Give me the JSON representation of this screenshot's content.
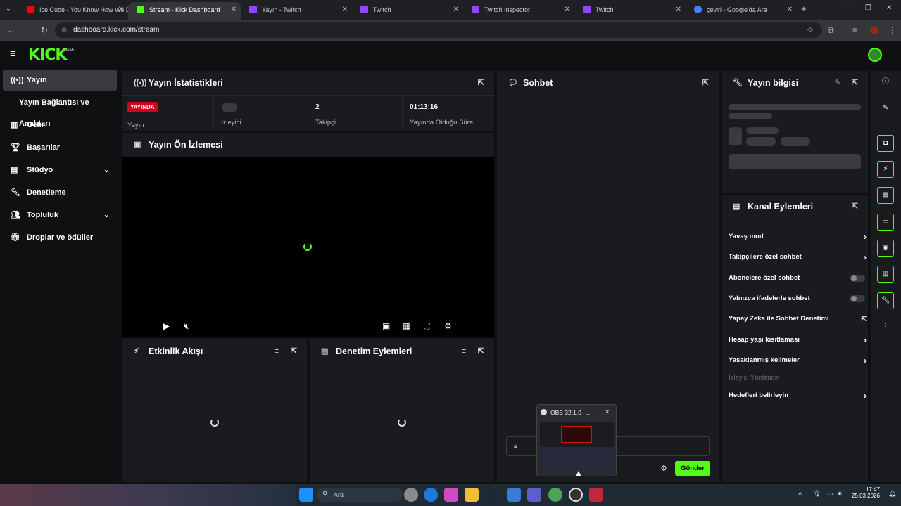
{
  "browser": {
    "tabs": [
      {
        "title": "Ice Cube - You Know How We D",
        "color": "#ff0000"
      },
      {
        "title": "Stream - Kick Dashboard",
        "color": "#53fc18"
      },
      {
        "title": "Yayın - Twitch",
        "color": "#9146ff"
      },
      {
        "title": "Twitch",
        "color": "#9146ff"
      },
      {
        "title": "Twitch Inspector",
        "color": "#9146ff"
      },
      {
        "title": "Twitch",
        "color": "#9146ff"
      },
      {
        "title": "çeviri - Google'da Ara",
        "color": "#4285f4"
      }
    ],
    "url": "dashboard.kick.com/stream"
  },
  "app": {
    "logo": "KICK",
    "beta": "BETA"
  },
  "sidebar": {
    "items": [
      {
        "label": "Yayın",
        "icon": "broadcast-icon"
      },
      {
        "label": "Yayın Bağlantısı ve Anahtarı",
        "icon": ""
      },
      {
        "label": "Gelir",
        "icon": "chart-icon"
      },
      {
        "label": "Başarılar",
        "icon": "trophy-icon"
      },
      {
        "label": "Stüdyo",
        "icon": "studio-icon"
      },
      {
        "label": "Denetleme",
        "icon": "wrench-icon"
      },
      {
        "label": "Topluluk",
        "icon": "people-icon"
      },
      {
        "label": "Droplar ve ödüller",
        "icon": "gift-icon"
      }
    ]
  },
  "stats": {
    "title": "Yayın İstatistikleri",
    "live_badge": "YAYINDA",
    "live_label": "Yayın",
    "viewers_label": "İzleyici",
    "followers_value": "2",
    "followers_label": "Takipçi",
    "uptime_value": "01:13:16",
    "uptime_label": "Yayında Olduğu Süre"
  },
  "preview": {
    "title": "Yayın Ön İzlemesi"
  },
  "activity": {
    "title": "Etkinlik Akışı"
  },
  "moderation": {
    "title": "Denetim Eylemleri"
  },
  "chat": {
    "title": "Sohbet",
    "send_label": "Gönder"
  },
  "info": {
    "title": "Yayın bilgisi"
  },
  "channel_actions": {
    "title": "Kanal Eylemleri",
    "items": [
      {
        "label": "Yavaş mod",
        "kind": "arrow"
      },
      {
        "label": "Takipçilere özel sohbet",
        "kind": "arrow"
      },
      {
        "label": "Abonelere özel sohbet",
        "kind": "toggle"
      },
      {
        "label": "Yalnızca ifadelerle sohbet",
        "kind": "toggle"
      },
      {
        "label": "Yapay Zeka ile Sohbet Denetimi",
        "kind": "external"
      },
      {
        "label": "Hesap yaşı kısıtlaması",
        "kind": "arrow"
      },
      {
        "label": "Yasaklanmış kelimeler",
        "kind": "arrow"
      },
      {
        "label": "İzleyici Yönlendir",
        "kind": "disabled"
      },
      {
        "label": "Hedefleri belirleyin",
        "kind": "arrow"
      }
    ]
  },
  "obs_popup": {
    "title": "OBS 32.1.0 -..."
  },
  "taskbar": {
    "search_placeholder": "Ara",
    "time": "17:47",
    "date": "25.03.2026"
  },
  "colors": {
    "accent": "#53fc18",
    "live": "#e11d2a"
  }
}
